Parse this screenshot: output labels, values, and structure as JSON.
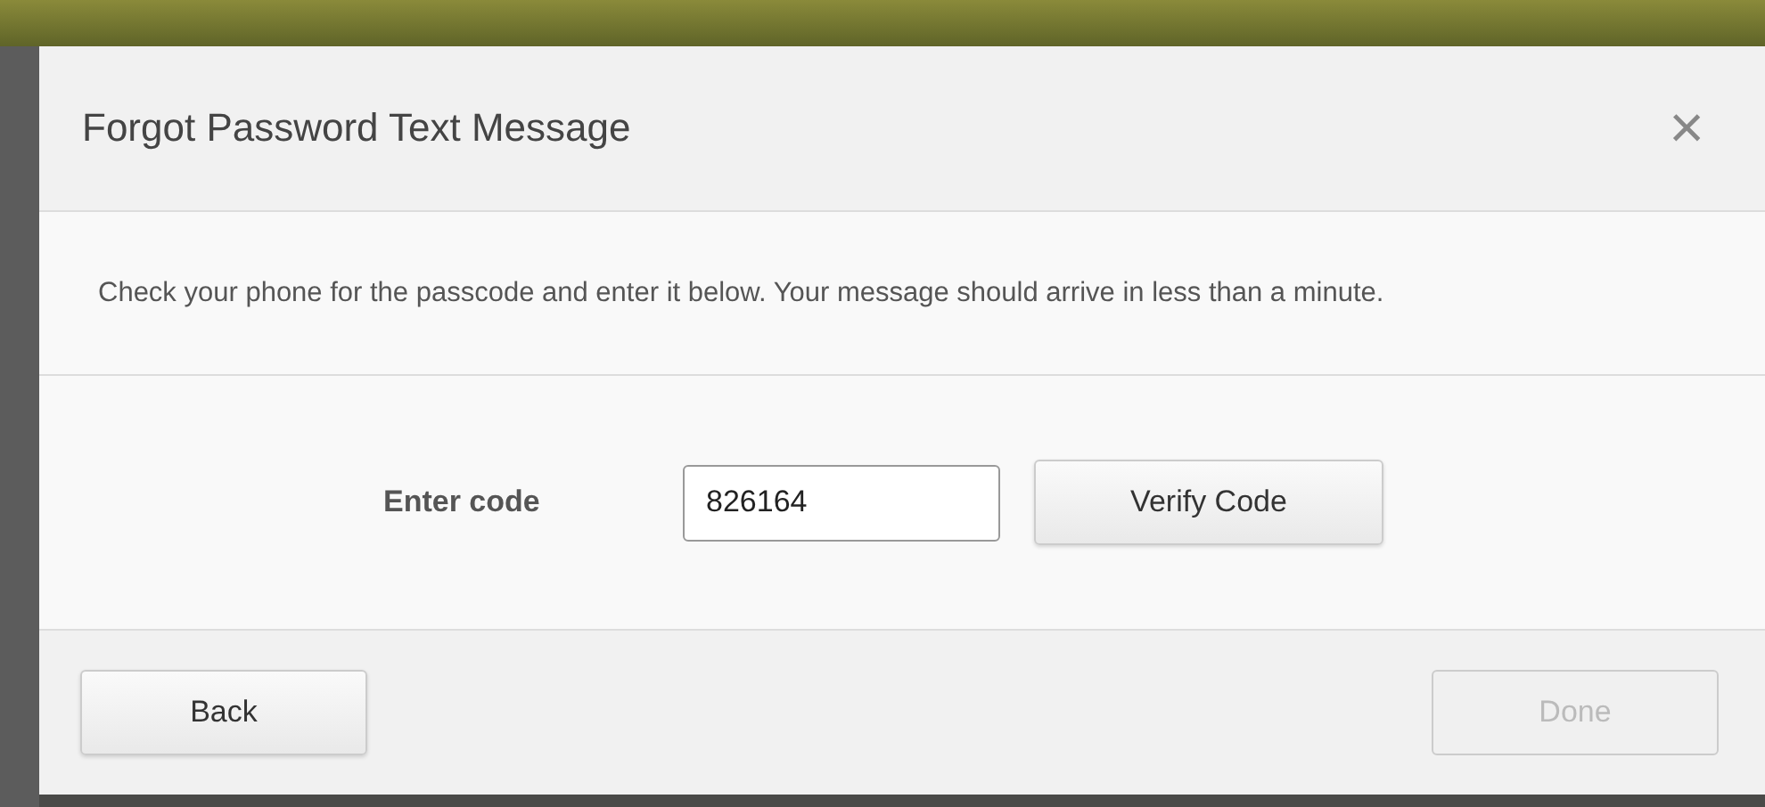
{
  "dialog": {
    "title": "Forgot Password Text Message",
    "close": "×",
    "message": "Check your phone for the passcode and enter it below. Your message should arrive in less than a minute.",
    "field": {
      "label": "Enter code",
      "value": "826164"
    },
    "verify_button": {
      "label": "Verify Code",
      "disabled": false
    },
    "back_button": {
      "label": "Back",
      "disabled": false
    },
    "done_button": {
      "label": "Done",
      "disabled": true
    }
  }
}
